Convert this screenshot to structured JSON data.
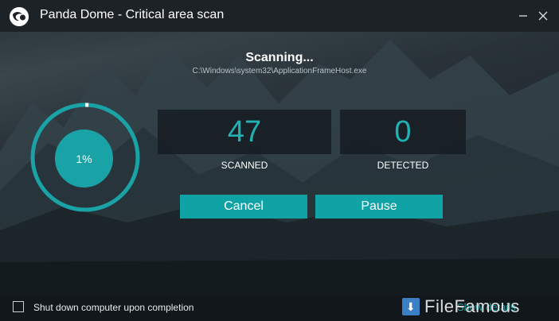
{
  "window": {
    "title": "Panda Dome - Critical area scan",
    "minimize_icon": "minimize-icon",
    "close_icon": "close-icon"
  },
  "scan": {
    "status": "Scanning...",
    "current_path": "C:\\Windows\\system32\\ApplicationFrameHost.exe",
    "progress_percent": 1,
    "progress_label": "1%"
  },
  "stats": {
    "scanned_value": "47",
    "scanned_label": "SCANNED",
    "detected_value": "0",
    "detected_label": "DETECTED"
  },
  "actions": {
    "cancel_label": "Cancel",
    "pause_label": "Pause"
  },
  "footer": {
    "shutdown_label": "Shut down computer upon completion",
    "shutdown_checked": false,
    "show_details_label": "Show details",
    "watermark": "FileFamous"
  },
  "colors": {
    "accent": "#1aa3a6",
    "titlebar": "#1d2226",
    "text": "#ffffff"
  }
}
